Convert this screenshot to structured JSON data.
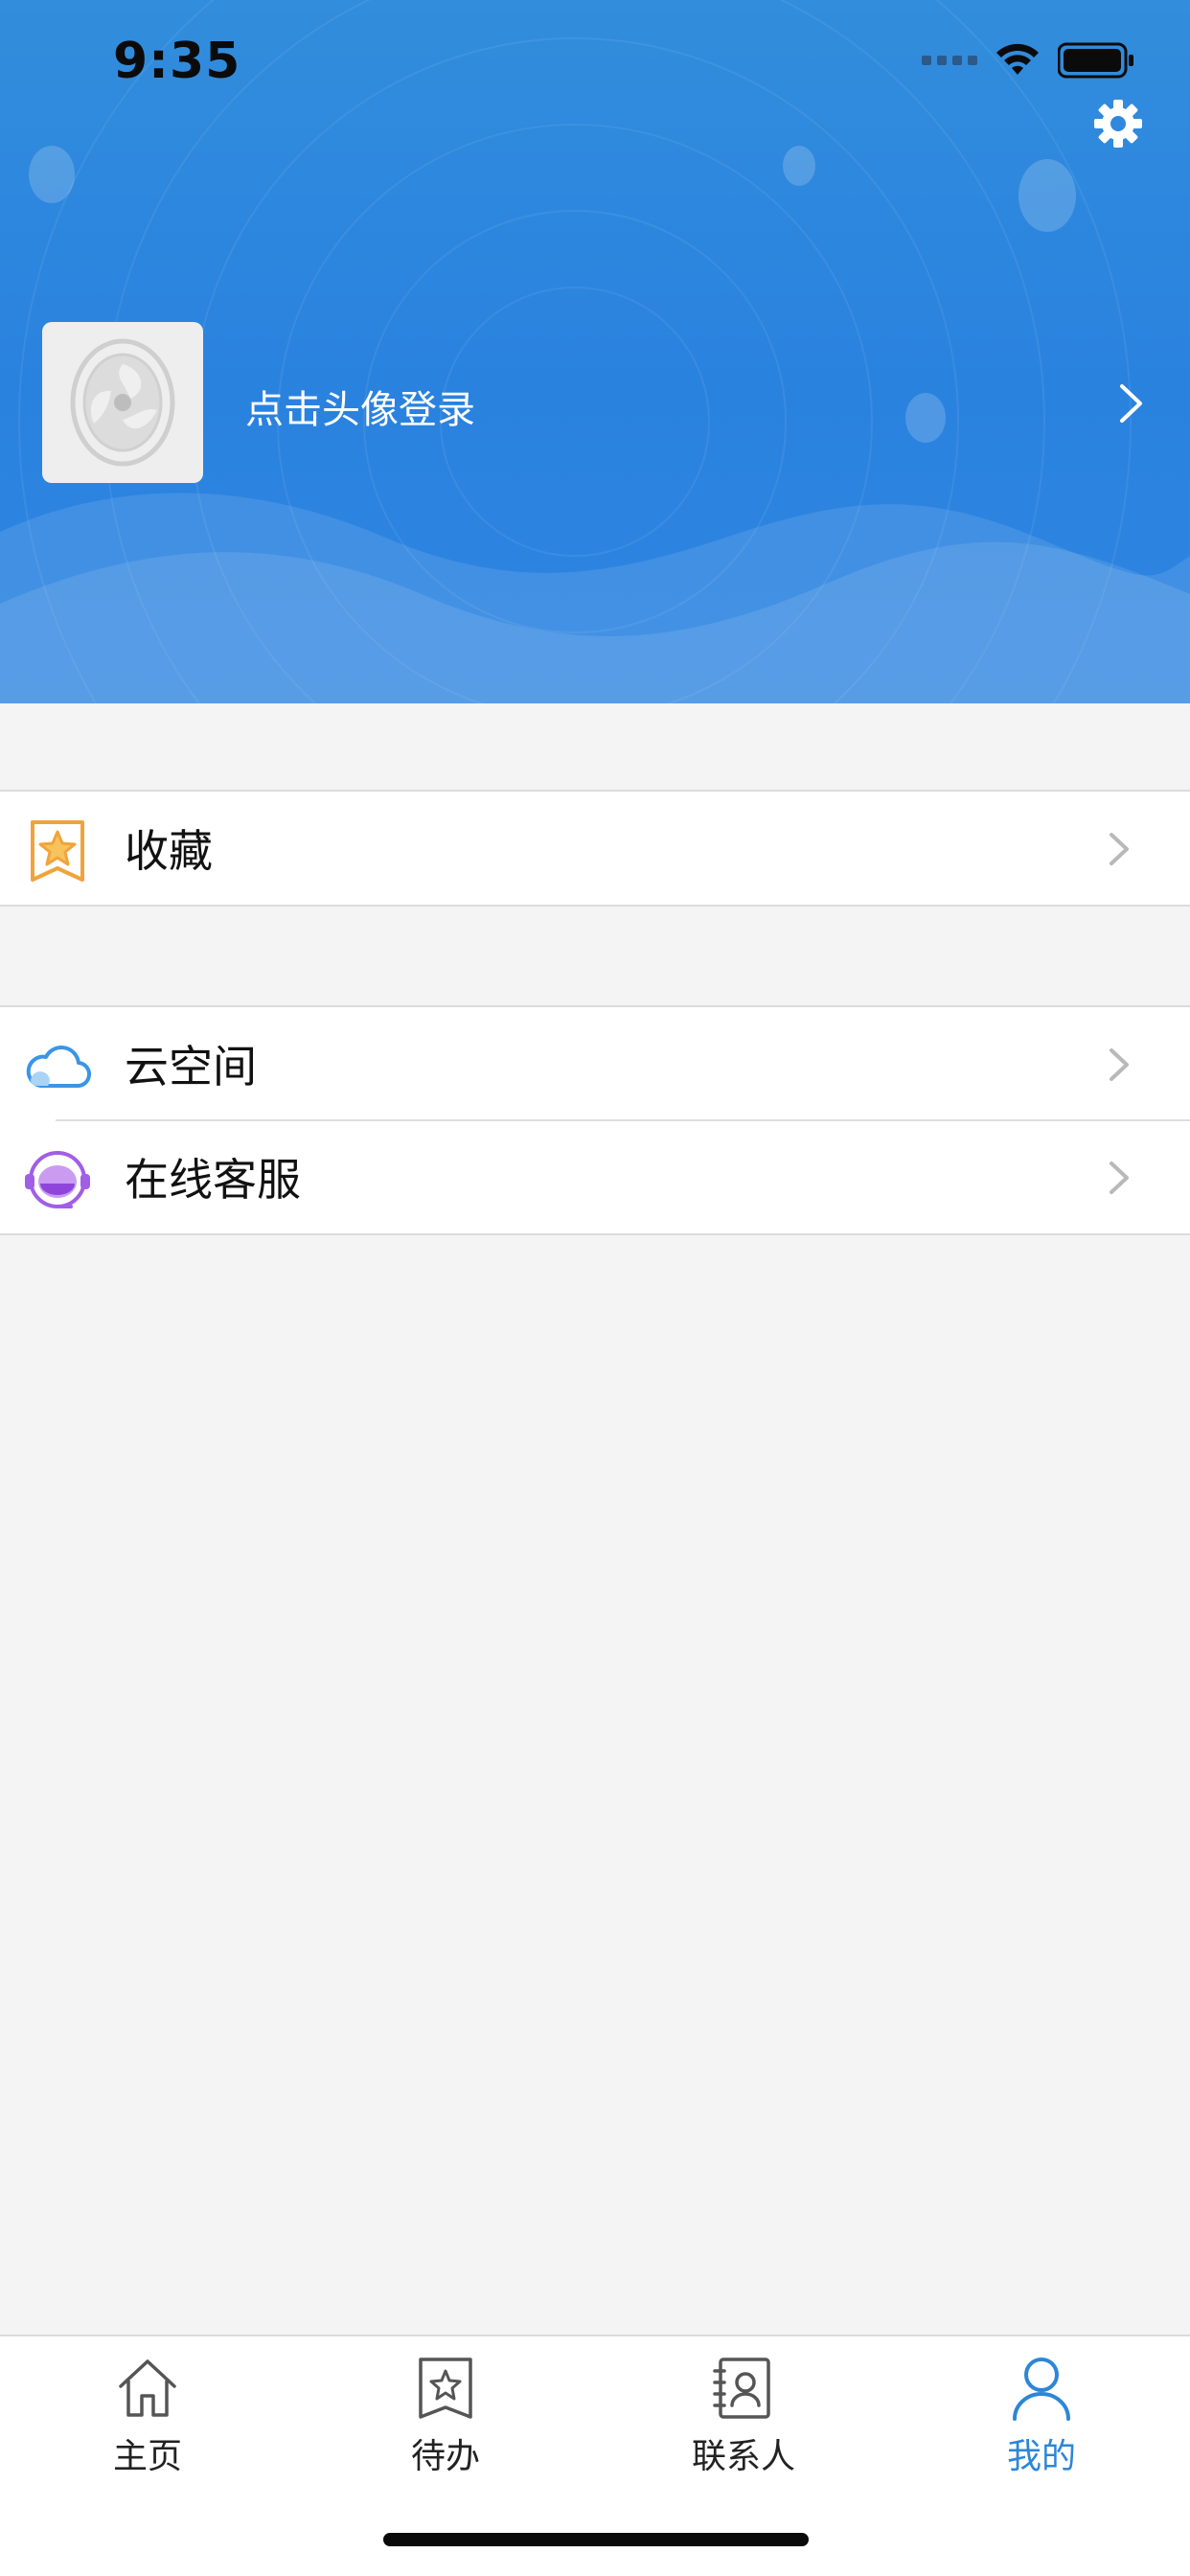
{
  "status_bar": {
    "time": "9:35"
  },
  "header": {
    "login_prompt": "点击头像登录",
    "settings_icon": "gear-icon",
    "colors": {
      "top": "#328ddc",
      "bottom": "#2f86e1"
    }
  },
  "menu": {
    "groups": [
      [
        {
          "label": "收藏",
          "icon": "bookmark-star-icon"
        }
      ],
      [
        {
          "label": "云空间",
          "icon": "cloud-icon"
        },
        {
          "label": "在线客服",
          "icon": "headset-icon"
        }
      ]
    ]
  },
  "tabbar": {
    "items": [
      {
        "label": "主页",
        "icon": "home-icon",
        "active": false
      },
      {
        "label": "待办",
        "icon": "todo-star-icon",
        "active": false
      },
      {
        "label": "联系人",
        "icon": "contacts-icon",
        "active": false
      },
      {
        "label": "我的",
        "icon": "person-icon",
        "active": true
      }
    ],
    "active_color": "#2d86d6"
  }
}
